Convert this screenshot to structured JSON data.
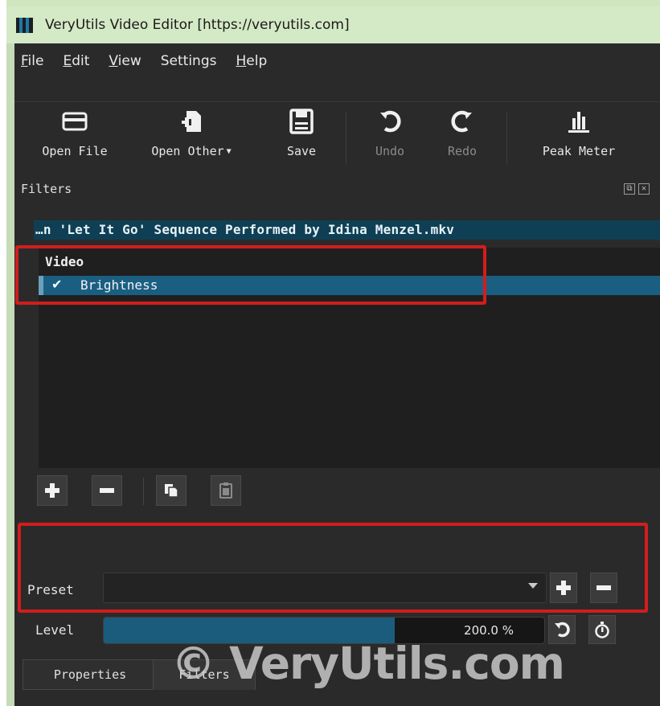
{
  "window": {
    "title": "VeryUtils Video Editor [https://veryutils.com]"
  },
  "menu": [
    {
      "label": "File",
      "accel": "F",
      "rest": "ile"
    },
    {
      "label": "Edit",
      "accel": "E",
      "rest": "dit"
    },
    {
      "label": "View",
      "accel": "V",
      "rest": "iew"
    },
    {
      "label": "Settings",
      "accel": "",
      "rest": "Settings"
    },
    {
      "label": "Help",
      "accel": "H",
      "rest": "elp"
    }
  ],
  "toolbar": {
    "open_file": {
      "label": "Open File",
      "icon": "folder-icon",
      "enabled": true
    },
    "open_other": {
      "label": "Open Other",
      "icon": "open-other-icon",
      "enabled": true
    },
    "save": {
      "label": "Save",
      "icon": "save-icon",
      "enabled": true
    },
    "undo": {
      "label": "Undo",
      "icon": "undo-icon",
      "enabled": false
    },
    "redo": {
      "label": "Redo",
      "icon": "redo-icon",
      "enabled": false
    },
    "peak_meter": {
      "label": "Peak Meter",
      "icon": "peak-meter-icon",
      "enabled": true
    }
  },
  "filters_dock": {
    "title": "Filters",
    "clip_name": "…n 'Let It Go' Sequence Performed by Idina Menzel.mkv",
    "group_label": "Video",
    "items": [
      {
        "name": "Brightness",
        "checked": true,
        "check_glyph": "✔",
        "selected": true
      }
    ],
    "buttons": [
      {
        "name": "add-filter-button",
        "icon": "plus-icon",
        "enabled": true
      },
      {
        "name": "remove-filter-button",
        "icon": "minus-icon",
        "enabled": true
      },
      {
        "name": "copy-filter-button",
        "icon": "copy-icon",
        "enabled": true
      },
      {
        "name": "paste-filter-button",
        "icon": "clipboard-icon",
        "enabled": false
      }
    ]
  },
  "properties": {
    "preset_label": "Preset",
    "preset_value": "",
    "level_label": "Level",
    "level_value": "200.0 %",
    "level_fraction": 0.66
  },
  "tabs": [
    {
      "label": "Properties",
      "active": false
    },
    {
      "label": "Filters",
      "active": true
    }
  ],
  "watermark": "© VeryUtils.com",
  "colors": {
    "accent": "#1a5f82",
    "highlight_box": "#d21d1d",
    "panel_bg": "#2a2a2a",
    "titlebar_bg": "#d4e9c5"
  }
}
